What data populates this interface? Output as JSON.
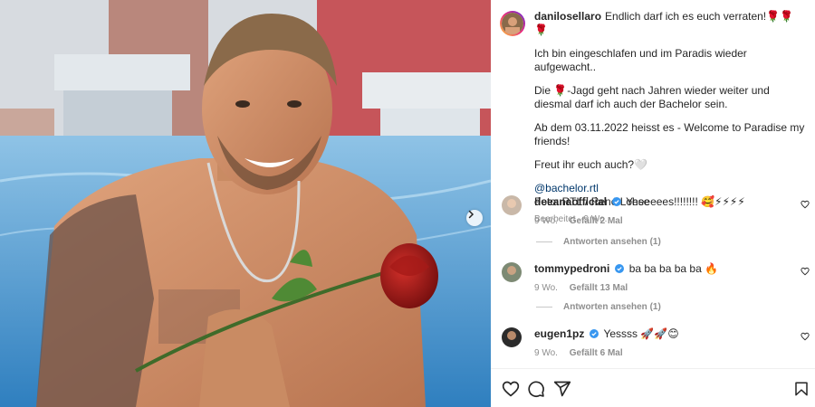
{
  "post": {
    "username": "danilosellaro",
    "caption_first": "Endlich darf ich es euch verraten!🌹🌹🌹",
    "paragraphs": [
      "Ich bin eingeschlafen und im Paradis wieder aufgewacht..",
      "Die 🌹-Jagd geht nach Jahren wieder weiter und diesmal darf ich auch der Bachelor sein.",
      "Ab dem 03.11.2022 heisst es - Welcome to Paradise my friends!",
      "Freut ihr euch auch?🤍"
    ],
    "mention": "@bachelor.rtl",
    "credit": "Foto: RTL / René Lohse",
    "edited_time": "Bearbeitet · 9 Wo."
  },
  "comments": [
    {
      "username": "deeanaofficial",
      "verified": true,
      "text": "Yeeeeees!!!!!!!! 🥰⚡⚡⚡⚡",
      "time": "9 Wo.",
      "likes": "Gefällt 2 Mal",
      "replies": "Antworten ansehen (1)"
    },
    {
      "username": "tommypedroni",
      "verified": true,
      "text": "ba ba ba ba ba 🔥",
      "time": "9 Wo.",
      "likes": "Gefällt 13 Mal",
      "replies": "Antworten ansehen (1)"
    },
    {
      "username": "eugen1pz",
      "verified": true,
      "text": "Yessss 🚀🚀😊",
      "time": "9 Wo.",
      "likes": "Gefällt 6 Mal"
    }
  ],
  "icons": {
    "like": "heart-icon",
    "comment": "comment-icon",
    "share": "share-icon",
    "save": "bookmark-icon",
    "next": "chevron-right-icon",
    "verified": "verified-badge-icon"
  },
  "colors": {
    "verified": "#3897f0",
    "link": "#00376b",
    "muted": "#8e8e8e",
    "text": "#262626"
  }
}
